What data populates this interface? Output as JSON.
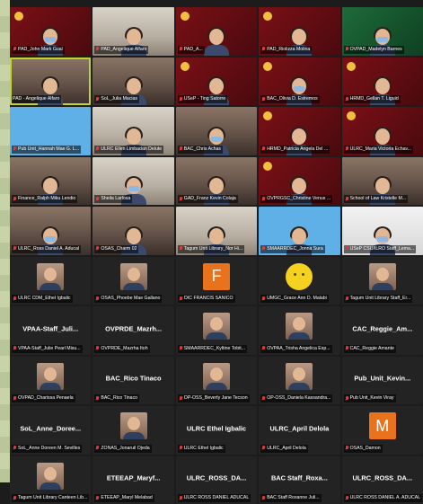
{
  "colors": {
    "accent_orange": "#e8731c",
    "muted_red": "#e03a3a",
    "active_border": "#c5d22a"
  },
  "tiles": [
    {
      "label": "PAD_John Mark Gual",
      "kind": "video red",
      "muted": true
    },
    {
      "label": "PAD_Angelique Alfaro",
      "kind": "video office",
      "muted": true
    },
    {
      "label": "PAD_A...",
      "kind": "video red",
      "muted": true
    },
    {
      "label": "PAD_Riolizza Molina",
      "kind": "video red",
      "muted": true
    },
    {
      "label": "OVPAD_Madelyn Barnes",
      "kind": "video green",
      "muted": true
    },
    {
      "label": "PAD - Angelique Alfaro",
      "kind": "video highlight",
      "muted": false
    },
    {
      "label": "SoL_Julia Macias",
      "kind": "video",
      "muted": true
    },
    {
      "label": "USeP - Ting Satorre",
      "kind": "video red",
      "muted": true
    },
    {
      "label": "BAC_Olivia D. Estremos",
      "kind": "video red",
      "muted": true
    },
    {
      "label": "HRMD_Gellan T. Liguid",
      "kind": "video red",
      "muted": true
    },
    {
      "label": "Pub Unit_Hannah Mae G. L...",
      "kind": "lightblue",
      "muted": true
    },
    {
      "label": "ULRC Ellen Limbadan Delute",
      "kind": "video office",
      "muted": true
    },
    {
      "label": "BAC_Chris Achas",
      "kind": "video",
      "muted": true
    },
    {
      "label": "HRMD_Patricia Angela Del ...",
      "kind": "video red",
      "muted": true
    },
    {
      "label": "ULRC_Maria Victoria Echav...",
      "kind": "video red",
      "muted": true
    },
    {
      "label": "Finance_Ralph Miku Lendio",
      "kind": "video",
      "muted": true
    },
    {
      "label": "Sheila Larlosa",
      "kind": "video office",
      "muted": true
    },
    {
      "label": "GAD_Franz Kevin Colaja",
      "kind": "video",
      "muted": true
    },
    {
      "label": "OVPRGSC_Christine Venus ...",
      "kind": "video red",
      "muted": true
    },
    {
      "label": "School of Law Kristelle M...",
      "kind": "video",
      "muted": true
    },
    {
      "label": "ULRC_Ross Daniel A. Aducal",
      "kind": "video",
      "muted": true
    },
    {
      "label": "OSAS_Charm 02",
      "kind": "video",
      "muted": true
    },
    {
      "label": "Tagum Unit Library_Nor Hi...",
      "kind": "video office",
      "muted": true
    },
    {
      "label": "SMAARRDEC_Jonna Sura",
      "kind": "video lightblue",
      "muted": true
    },
    {
      "label": "USeP CSU/ILRO Staff_Lema...",
      "kind": "video white",
      "muted": true
    },
    {
      "label": "ULRC CDM_Ethel Igbalic",
      "kind": "avatar-photo",
      "muted": true
    },
    {
      "label": "OSAS_Phoebe Mae Gallano",
      "kind": "avatar-photo",
      "muted": true
    },
    {
      "label": "OIC FRANCIS SANICO",
      "kind": "avatar-letter",
      "letter": "F",
      "muted": true
    },
    {
      "label": "UMGC_Grace Ann D. Malabi",
      "kind": "avatar-emoji",
      "muted": true
    },
    {
      "label": "Tagum Unit Library Staff_Er...",
      "kind": "avatar-photo",
      "muted": true
    },
    {
      "label": "VPAA-Staff_Julie Pearl Misu...",
      "kind": "name",
      "name": "VPAA-Staff_Juli...",
      "muted": true
    },
    {
      "label": "OVPRDE_Mazrha Itoh",
      "kind": "name",
      "name": "OVPRDE_Mazrh...",
      "muted": true
    },
    {
      "label": "SMAARRDEC_Kyltine Tobit...",
      "kind": "avatar-photo",
      "muted": true
    },
    {
      "label": "OVPAA_Trisha Angelica Esp...",
      "kind": "avatar-photo",
      "muted": true
    },
    {
      "label": "CAC_Reggie Amante",
      "kind": "name",
      "name": "CAC_Reggie_Am...",
      "muted": true
    },
    {
      "label": "OVPAD_Charissa Penaela",
      "kind": "avatar-photo",
      "muted": true
    },
    {
      "label": "BAC_Rico Tinaco",
      "kind": "name",
      "name": "BAC_Rico Tinaco",
      "muted": true
    },
    {
      "label": "OP-OSS_Beverly Jane Tecson",
      "kind": "avatar-photo",
      "muted": true
    },
    {
      "label": "OP-OSS_Daniela Kassandra...",
      "kind": "avatar-photo",
      "muted": true
    },
    {
      "label": "Pub Unit_Kevin Viray",
      "kind": "name",
      "name": "Pub_Unit_Kevin...",
      "muted": true
    },
    {
      "label": "SoL_Anne Doreen M. Sevilles",
      "kind": "name",
      "name": "SoL_Anne_Doree...",
      "muted": true
    },
    {
      "label": "ZONAS_Jonaruil Ojeda",
      "kind": "avatar-photo",
      "muted": true
    },
    {
      "label": "ULRC Ethel Igbalic",
      "kind": "name",
      "name": "ULRC Ethel Igbalic",
      "muted": true
    },
    {
      "label": "ULRC_April Delola",
      "kind": "name",
      "name": "ULRC_April Delola",
      "muted": true
    },
    {
      "label": "OSAS_Damon",
      "kind": "avatar-letter-orange",
      "letter": "M",
      "muted": true
    },
    {
      "label": "Tagum Unit Library Canteen Lib...",
      "kind": "avatar-photo",
      "muted": true
    },
    {
      "label": "ETEEAP_Maryl Melabad",
      "kind": "name",
      "name": "ETEEAP_Maryf...",
      "muted": true
    },
    {
      "label": "ULRC ROSS DANIEL ADUCAL",
      "kind": "name",
      "name": "ULRC_ROSS_DA...",
      "muted": true
    },
    {
      "label": "BAC Staff Roxanne Juli...",
      "kind": "name",
      "name": "BAC Staff_Roxa...",
      "muted": true
    },
    {
      "label": "ULRC ROSS DANIEL A. ADUCAL",
      "kind": "name",
      "name": "ULRC_ROSS_DA...",
      "muted": true
    }
  ]
}
